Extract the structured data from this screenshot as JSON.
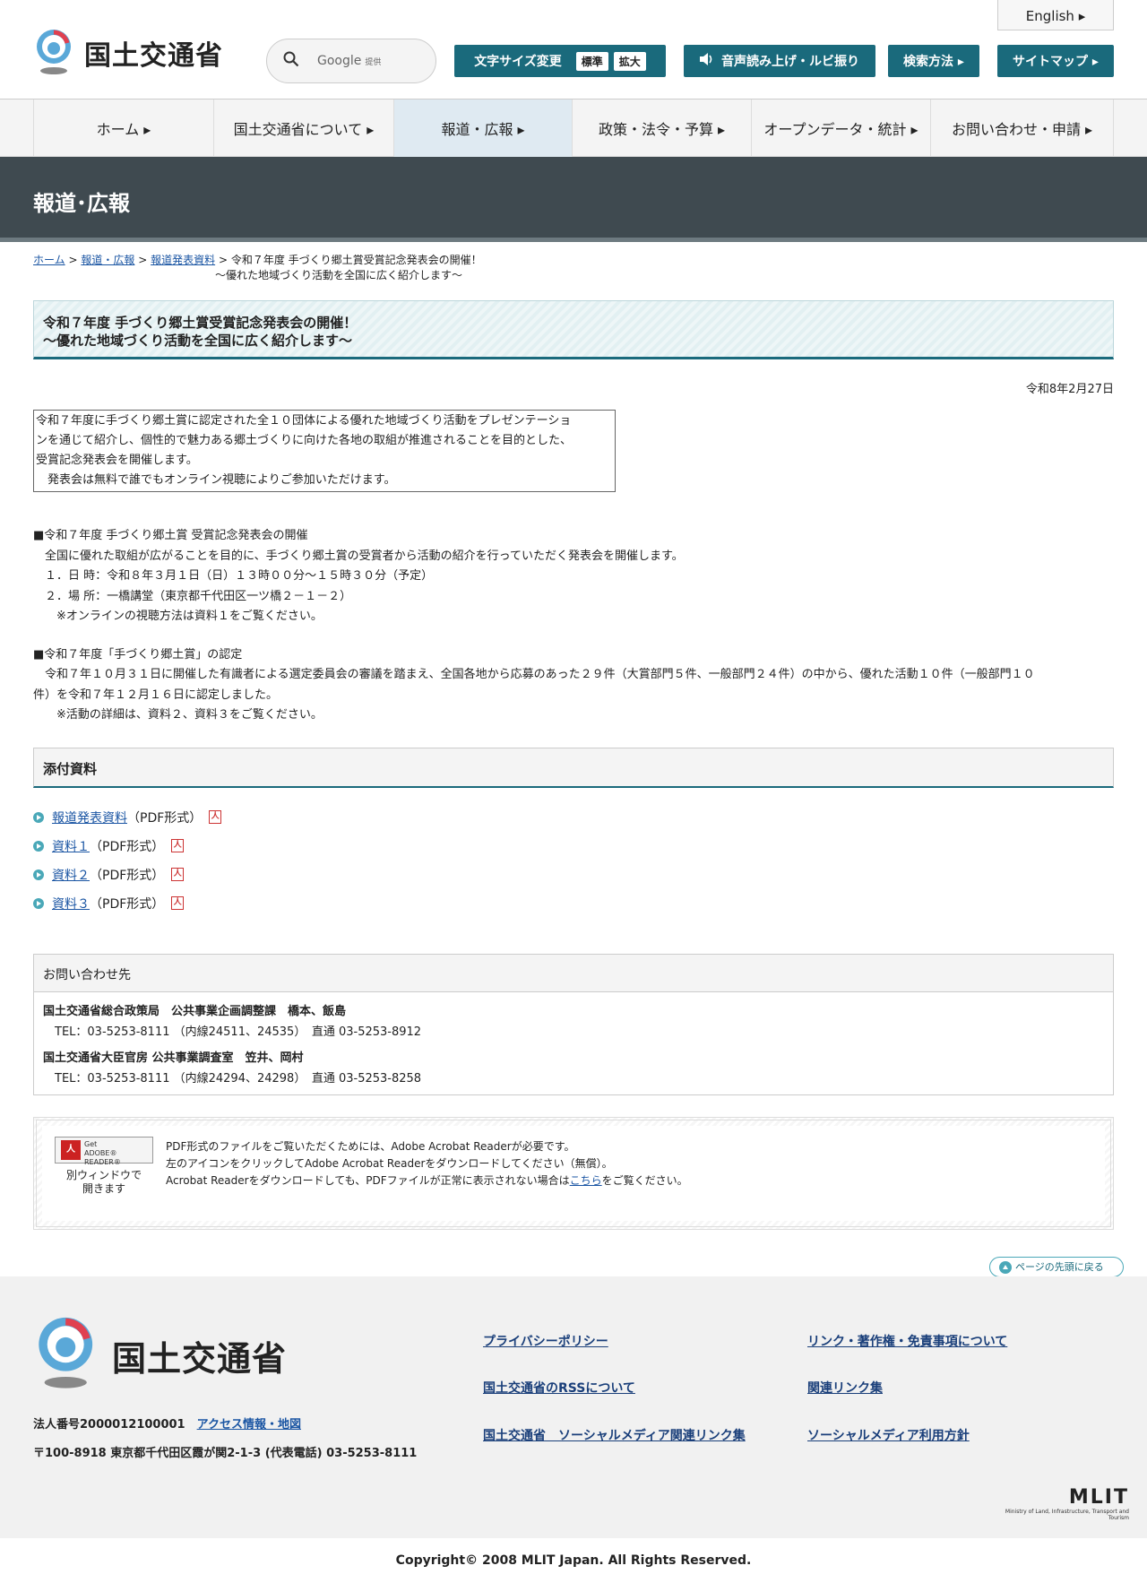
{
  "header": {
    "logo_text": "国土交通省",
    "search_label": "Google",
    "search_sub": "提供",
    "english": "English ▸",
    "font_size_label": "文字サイズ変更",
    "font_std": "標準",
    "font_large": "拡大",
    "voice": "音声読み上げ・ルビ振り",
    "search_method": "検索方法 ▸",
    "sitemap": "サイトマップ ▸"
  },
  "gnav": [
    {
      "label": "ホーム ▸"
    },
    {
      "label": "国土交通省について ▸"
    },
    {
      "label": "報道・広報 ▸"
    },
    {
      "label": "政策・法令・予算 ▸"
    },
    {
      "label": "オープンデータ・統計 ▸"
    },
    {
      "label": "お問い合わせ・申請 ▸"
    }
  ],
  "band_title": "報道･広報",
  "breadcrumb": {
    "home": "ホーム",
    "press": "報道・広報",
    "release": "報道発表資料",
    "sep": ">",
    "current1": "令和７年度 手づくり郷土賞受賞記念発表会の開催！",
    "current2": "～優れた地域づくり活動を全国に広く紹介します～"
  },
  "title": {
    "line1": "令和７年度 手づくり郷土賞受賞記念発表会の開催！",
    "line2": "～優れた地域づくり活動を全国に広く紹介します～"
  },
  "date": "令和8年2月27日",
  "lead": {
    "l1": "令和７年度に手づくり郷土賞に認定された全１０団体による優れた地域づくり活動をプレゼンテーショ",
    "l2": "ンを通じて紹介し、個性的で魅力ある郷土づくりに向けた各地の取組が推進されることを目的とした、",
    "l3": "受賞記念発表会を開催します。",
    "l4": "　発表会は無料で誰でもオンライン視聴によりご参加いただけます。"
  },
  "section1": {
    "head": "■令和７年度 手づくり郷土賞 受賞記念発表会の開催",
    "l1": "　全国に優れた取組が広がることを目的に、手づくり郷土賞の受賞者から活動の紹介を行っていただく発表会を開催します。",
    "l2": "　１．日 時：令和８年３月１日（日）１３時００分～１５時３０分（予定）",
    "l3": "　２．場 所：一橋講堂（東京都千代田区一ツ橋２－１－２）",
    "l4": "　　※オンラインの視聴方法は資料１をご覧ください。"
  },
  "section2": {
    "head": "■令和７年度「手づくり郷土賞」の認定",
    "l1": "　令和７年１０月３１日に開催した有識者による選定委員会の審議を踏まえ、全国各地から応募のあった２９件（大賞部門５件、一般部門２４件）の中から、優れた活動１０件（一般部門１０",
    "l2": "件）を令和７年１２月１６日に認定しました。",
    "l3": "　　※活動の詳細は、資料２、資料３をご覧ください。"
  },
  "attachments": {
    "head": "添付資料",
    "items": [
      {
        "link": "報道発表資料",
        "fmt": "（PDF形式）"
      },
      {
        "link": "資料１",
        "fmt": "（PDF形式）"
      },
      {
        "link": "資料２",
        "fmt": "（PDF形式）"
      },
      {
        "link": "資料３",
        "fmt": "（PDF形式）"
      }
    ]
  },
  "contact": {
    "head": "お問い合わせ先",
    "org1": "国土交通省総合政策局　公共事業企画調整課　橋本、飯島",
    "tel1": "　TEL：03-5253-8111 （内線24511、24535）　直通 03-5253-8912",
    "org2": "国土交通省大臣官房 公共事業調査室　笠井、岡村",
    "tel2": "　TEL：03-5253-8111 （内線24294、24298）　直通 03-5253-8258"
  },
  "acrobat": {
    "badge1": "Get",
    "badge2": "ADOBE® READER®",
    "caption1": "別ウィンドウで",
    "caption2": "開きます",
    "t1": "PDF形式のファイルをご覧いただくためには、Adobe Acrobat Readerが必要です。",
    "t2": "左のアイコンをクリックしてAdobe Acrobat Readerをダウンロードしてください（無償）。",
    "t3a": "Acrobat Readerをダウンロードしても、PDFファイルが正常に表示されない場合は",
    "t3link": "こちら",
    "t3b": "をご覧ください。"
  },
  "to_top": "ページの先頭に戻る",
  "footer": {
    "logo_text": "国土交通省",
    "corp_no": "法人番号2000012100001",
    "access": "アクセス情報・地図",
    "address": "〒100-8918 東京都千代田区霞が関2-1-3 (代表電話) 03-5253-8111",
    "links": {
      "privacy": "プライバシーポリシー",
      "rss": "国土交通省のRSSについて",
      "social": "国土交通省　ソーシャルメディア関連リンク集",
      "copyright_links": "リンク・著作権・免責事項について",
      "related": "関連リンク集",
      "social_policy": "ソーシャルメディア利用方針"
    },
    "mlit": "MLIT",
    "mlit_sub": "Ministry of Land, Infrastructure, Transport and Tourism",
    "copyright": "Copyright© 2008 MLIT Japan. All Rights Reserved."
  },
  "colors": {
    "teal": "#1a6a7c",
    "band": "#3f4a50",
    "link": "#1a55a3"
  }
}
